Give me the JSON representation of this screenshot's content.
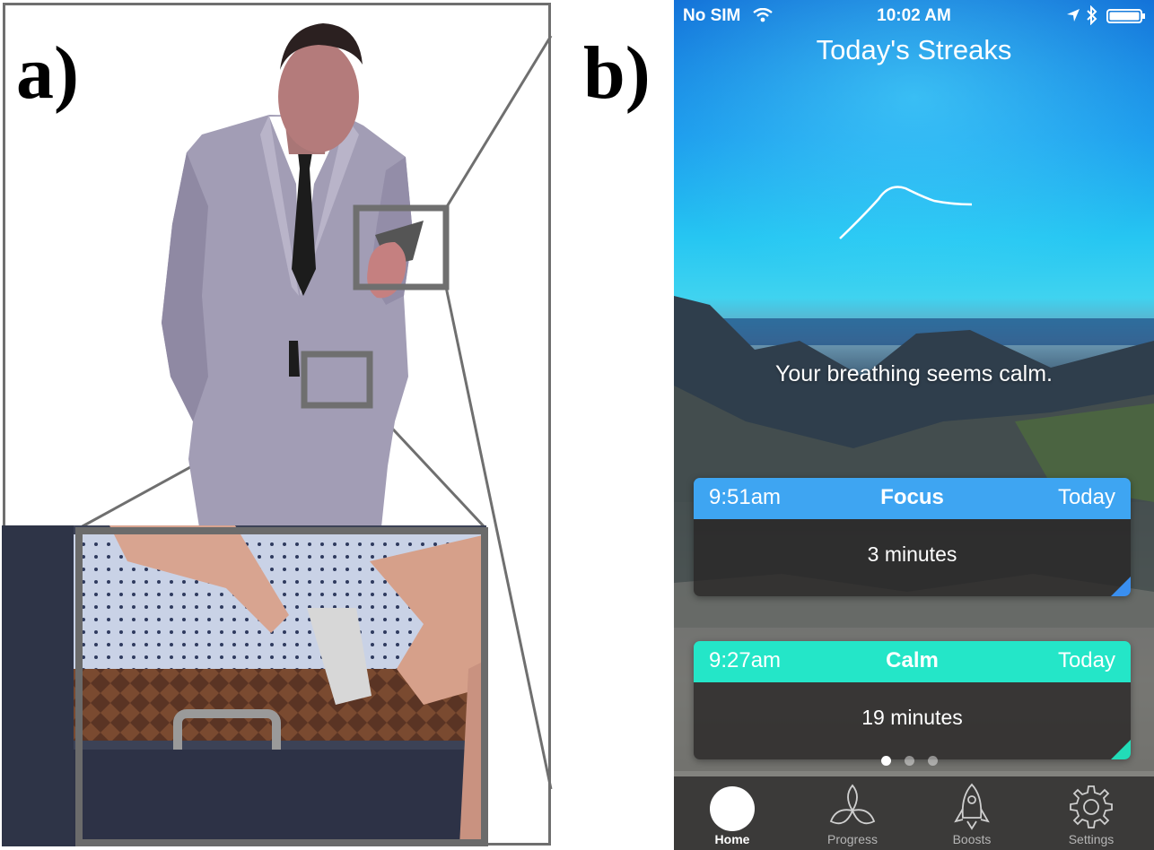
{
  "panel_labels": {
    "a": "a)",
    "b": "b)"
  },
  "status_bar": {
    "carrier": "No SIM",
    "time": "10:02 AM"
  },
  "screen": {
    "title": "Today's Streaks",
    "breathing_message": "Your breathing seems calm."
  },
  "streaks": [
    {
      "time": "9:51am",
      "type": "Focus",
      "day": "Today",
      "duration": "3 minutes",
      "color": "#3ea5f2"
    },
    {
      "time": "9:27am",
      "type": "Calm",
      "day": "Today",
      "duration": "19 minutes",
      "color": "#24e6c8"
    }
  ],
  "pager": {
    "pages": 3,
    "current": 1
  },
  "tab_bar": {
    "tabs": [
      {
        "label": "Home",
        "icon": "home-circle-icon",
        "active": true
      },
      {
        "label": "Progress",
        "icon": "flower-icon",
        "active": false
      },
      {
        "label": "Boosts",
        "icon": "rocket-icon",
        "active": false
      },
      {
        "label": "Settings",
        "icon": "gear-icon",
        "active": false
      }
    ]
  }
}
